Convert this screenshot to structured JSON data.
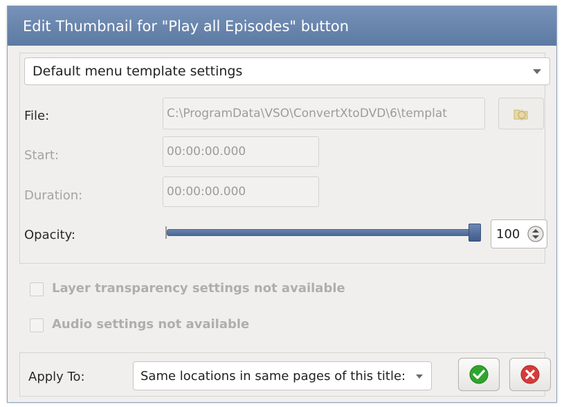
{
  "dialog": {
    "title": "Edit Thumbnail for \"Play all Episodes\" button",
    "template_select": {
      "value": "Default menu template settings"
    },
    "file": {
      "label": "File:",
      "value": "C:\\ProgramData\\VSO\\ConvertXtoDVD\\6\\templat"
    },
    "start": {
      "label": "Start:",
      "value": "00:00:00.000"
    },
    "duration": {
      "label": "Duration:",
      "value": "00:00:00.000"
    },
    "opacity": {
      "label": "Opacity:",
      "value": "100",
      "slider_fraction": 1.0
    },
    "layer_transparency": {
      "label": "Layer transparency settings not available",
      "checked": false
    },
    "audio_settings": {
      "label": "Audio settings not available",
      "checked": false
    },
    "apply_to": {
      "label": "Apply To:",
      "value": "Same locations in same pages of this title:"
    },
    "icons": {
      "browse": "folder-browse-icon",
      "ok": "checkmark-icon",
      "cancel": "cancel-x-icon",
      "spin": "spin-up-down-icon",
      "dropdown": "chevron-down-icon"
    },
    "colors": {
      "titlebar": "#6a86ae",
      "ok_green": "#2fa52f",
      "cancel_red": "#d63b3b"
    }
  }
}
